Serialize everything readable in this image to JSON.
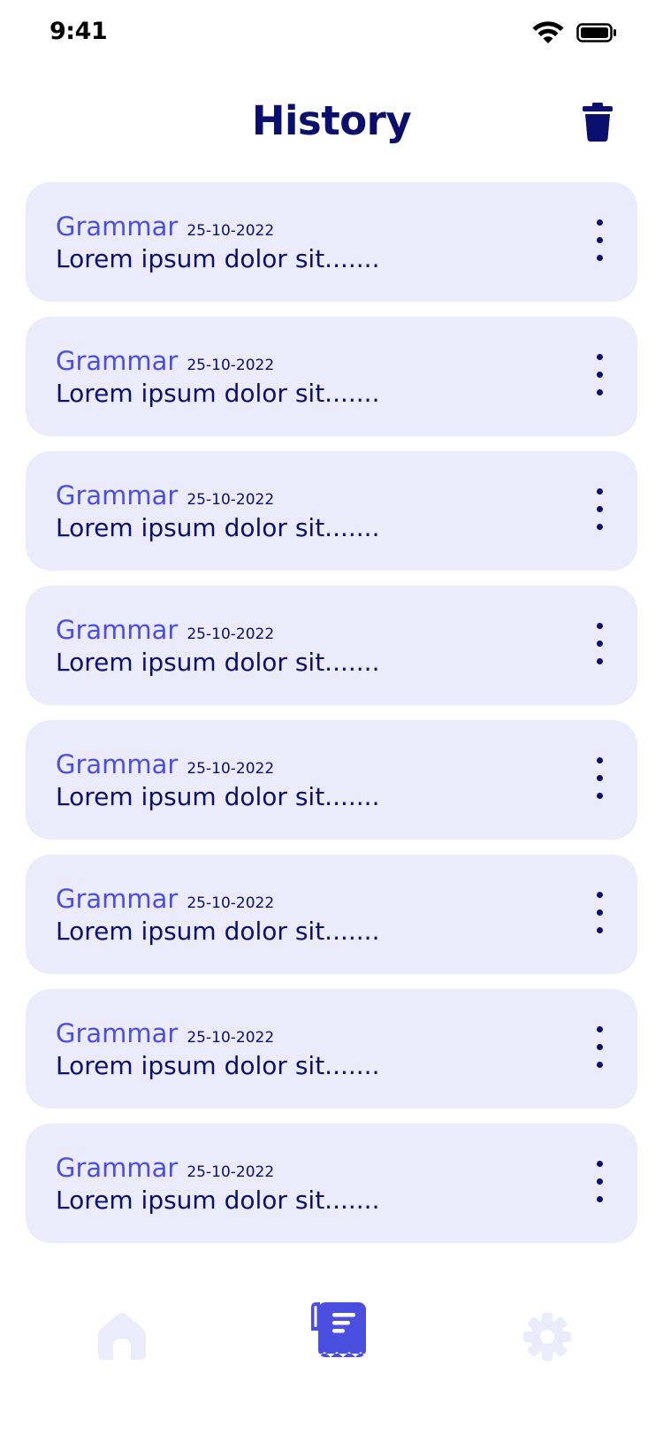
{
  "status_bar": {
    "time": "9:41",
    "icons": [
      "wifi-icon",
      "battery-icon"
    ]
  },
  "header": {
    "title": "History",
    "action_icon": "trash-icon"
  },
  "history": {
    "items": [
      {
        "title": "Grammar",
        "date": "25-10-2022",
        "text": "Lorem ipsum dolor sit......."
      },
      {
        "title": "Grammar",
        "date": "25-10-2022",
        "text": "Lorem ipsum dolor sit......."
      },
      {
        "title": "Grammar",
        "date": "25-10-2022",
        "text": "Lorem ipsum dolor sit......."
      },
      {
        "title": "Grammar",
        "date": "25-10-2022",
        "text": "Lorem ipsum dolor sit......."
      },
      {
        "title": "Grammar",
        "date": "25-10-2022",
        "text": "Lorem ipsum dolor sit......."
      },
      {
        "title": "Grammar",
        "date": "25-10-2022",
        "text": "Lorem ipsum dolor sit......."
      },
      {
        "title": "Grammar",
        "date": "25-10-2022",
        "text": "Lorem ipsum dolor sit......."
      },
      {
        "title": "Grammar",
        "date": "25-10-2022",
        "text": "Lorem ipsum dolor sit......."
      }
    ]
  },
  "tab_bar": {
    "tabs": [
      {
        "icon": "home-icon",
        "active": false
      },
      {
        "icon": "history-icon",
        "active": true
      },
      {
        "icon": "gear-icon",
        "active": false
      }
    ]
  },
  "colors": {
    "primary_dark": "#0a0f6e",
    "accent": "#4a4fe0",
    "card_bg": "#ecebfb",
    "tab_inactive": "#ecebfb",
    "tab_active": "#4a4fe0"
  }
}
